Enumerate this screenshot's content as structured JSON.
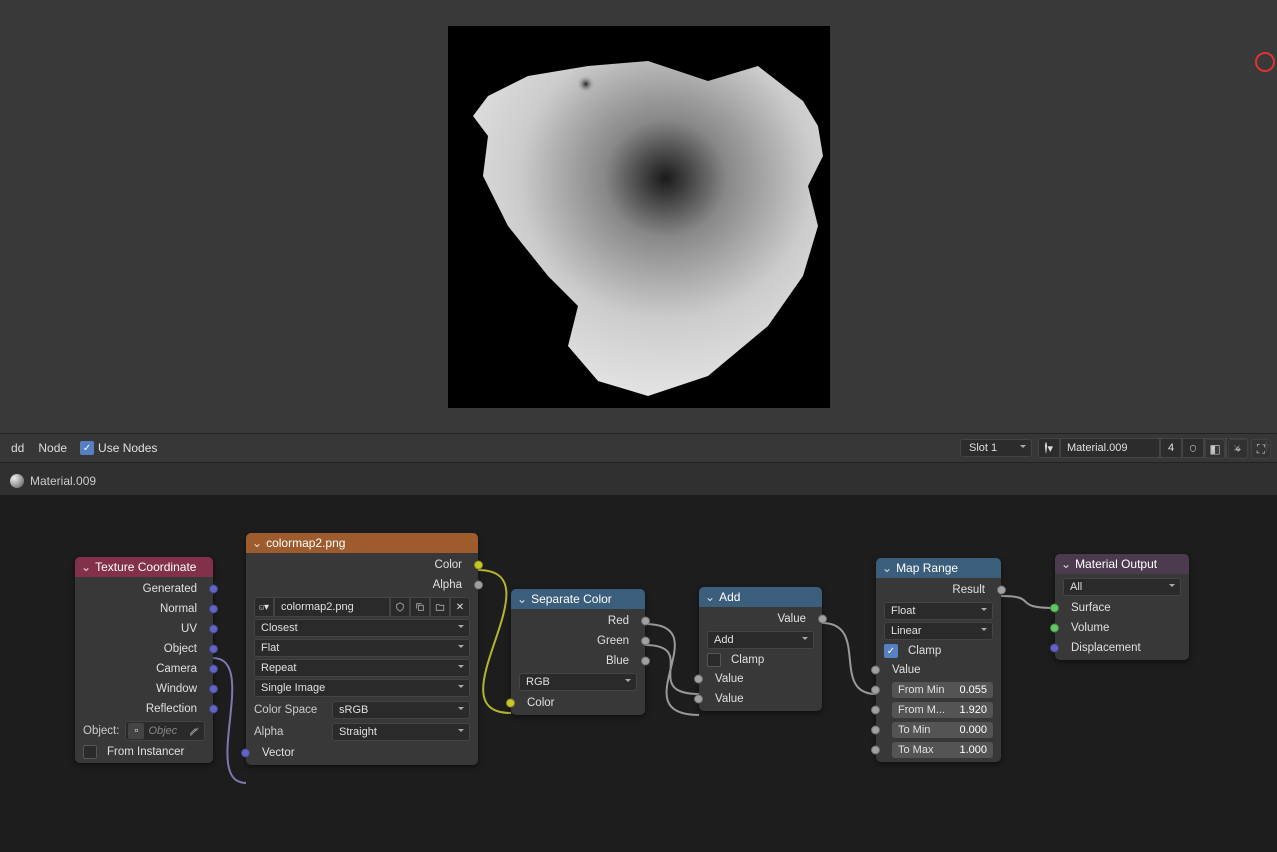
{
  "header": {
    "menu_add": "dd",
    "menu_node": "Node",
    "use_nodes": "Use Nodes",
    "slot": "Slot 1",
    "material_name": "Material.009",
    "user_count": "4"
  },
  "breadcrumb": {
    "material": "Material.009"
  },
  "nodes": {
    "texcoord": {
      "title": "Texture Coordinate",
      "outputs": [
        "Generated",
        "Normal",
        "UV",
        "Object",
        "Camera",
        "Window",
        "Reflection"
      ],
      "object_label": "Object:",
      "object_placeholder": "Objec",
      "from_instancer": "From Instancer"
    },
    "image": {
      "title": "colormap2.png",
      "out_color": "Color",
      "out_alpha": "Alpha",
      "filename": "colormap2.png",
      "interp": "Closest",
      "projection": "Flat",
      "extension": "Repeat",
      "source": "Single Image",
      "colorspace_label": "Color Space",
      "colorspace": "sRGB",
      "alpha_label": "Alpha",
      "alpha_mode": "Straight",
      "in_vector": "Vector"
    },
    "sepcolor": {
      "title": "Separate Color",
      "out_red": "Red",
      "out_green": "Green",
      "out_blue": "Blue",
      "mode": "RGB",
      "in_color": "Color"
    },
    "add": {
      "title": "Add",
      "out_value": "Value",
      "op": "Add",
      "clamp": "Clamp",
      "in_value1": "Value",
      "in_value2": "Value"
    },
    "maprange": {
      "title": "Map Range",
      "out_result": "Result",
      "data_type": "Float",
      "interp_type": "Linear",
      "clamp": "Clamp",
      "in_value": "Value",
      "from_min_label": "From Min",
      "from_min_val": "0.055",
      "from_max_label": "From M...",
      "from_max_val": "1.920",
      "to_min_label": "To Min",
      "to_min_val": "0.000",
      "to_max_label": "To Max",
      "to_max_val": "1.000"
    },
    "output": {
      "title": "Material Output",
      "target": "All",
      "in_surface": "Surface",
      "in_volume": "Volume",
      "in_displacement": "Displacement"
    }
  }
}
